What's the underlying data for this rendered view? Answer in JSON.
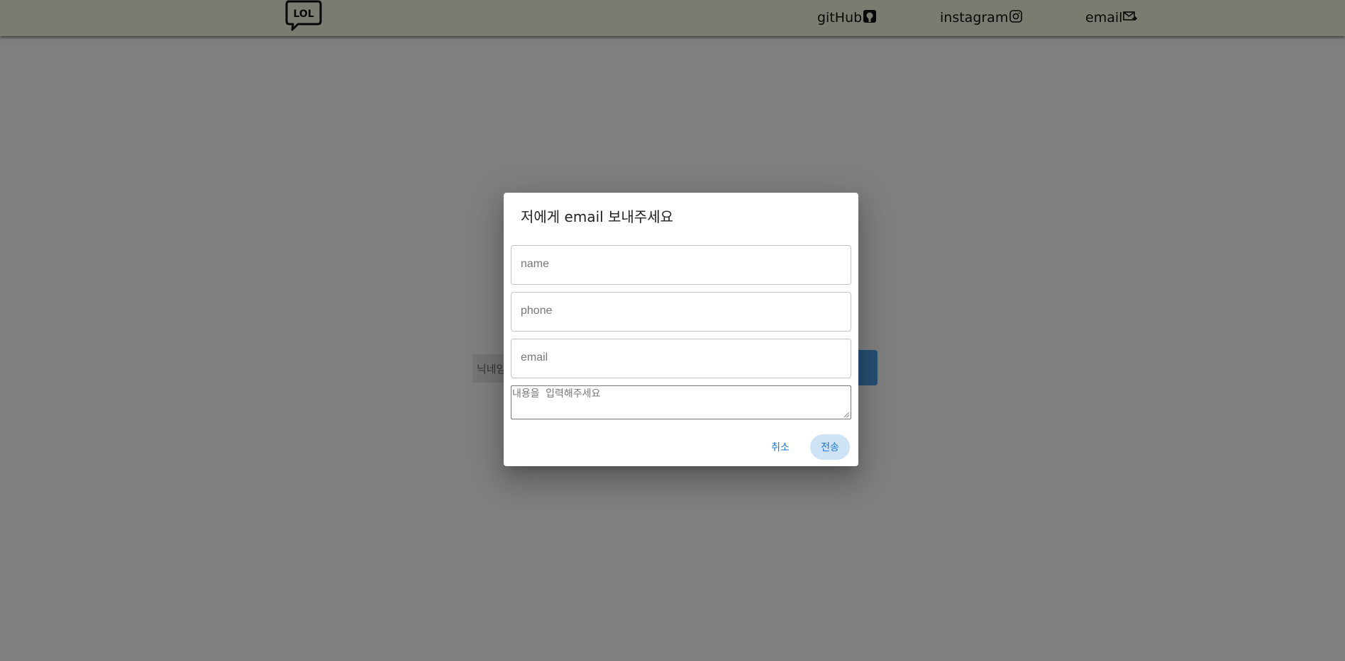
{
  "header": {
    "logo_text": "LOL",
    "nav": {
      "github_label": "gitHub",
      "instagram_label": "instagram",
      "email_label": "email"
    }
  },
  "background": {
    "input_placeholder": "닉네임"
  },
  "dialog": {
    "title": "저에게 email 보내주세요",
    "fields": {
      "name_placeholder": "name",
      "phone_placeholder": "phone",
      "email_placeholder": "email",
      "message_placeholder": "내용을 입력해주세요"
    },
    "actions": {
      "cancel_label": "취소",
      "send_label": "전송"
    }
  },
  "colors": {
    "header_bg": "#f8f6e4",
    "overlay": "rgba(0,0,0,0.5)",
    "accent": "#1976d2",
    "send_button_bg": "#cfe3f7"
  }
}
